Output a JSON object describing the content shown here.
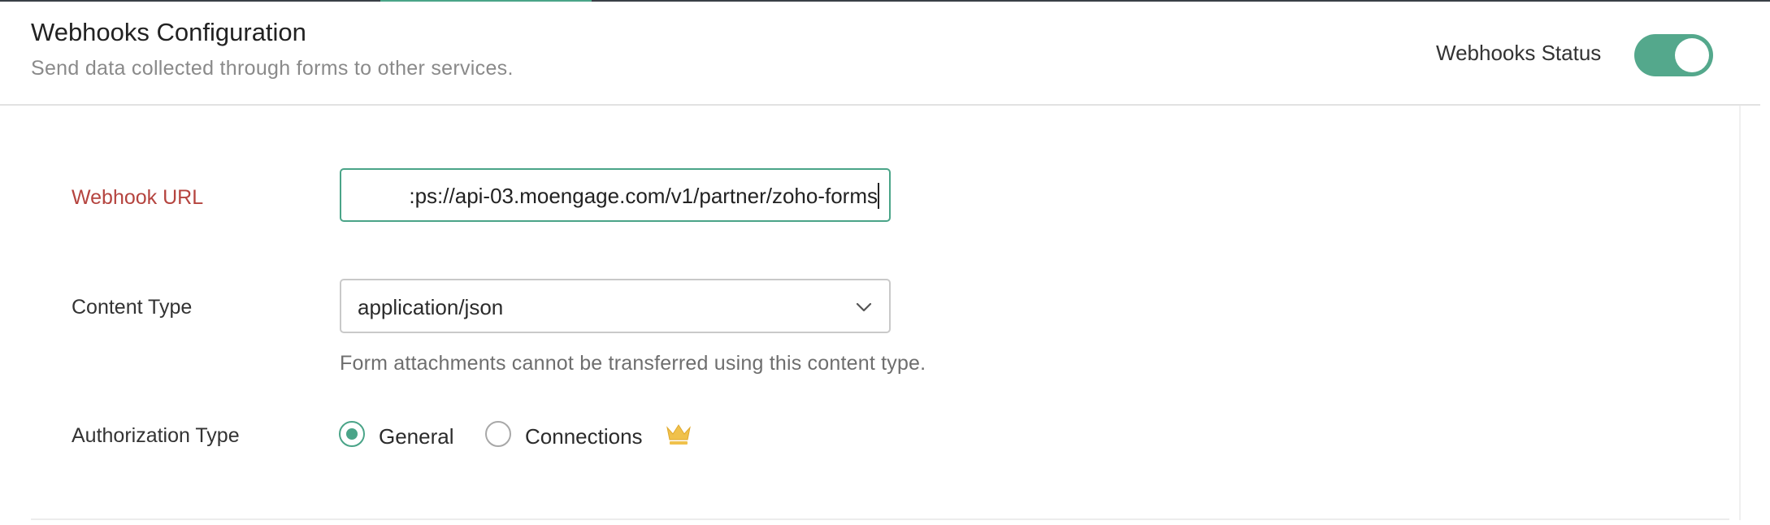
{
  "header": {
    "title": "Webhooks Configuration",
    "subtitle": "Send data collected through forms to other services.",
    "status_label": "Webhooks Status",
    "status_enabled": true
  },
  "form": {
    "webhook_url": {
      "label": "Webhook URL",
      "visible_value": ":ps://api-03.moengage.com/v1/partner/zoho-forms"
    },
    "content_type": {
      "label": "Content Type",
      "selected": "application/json",
      "hint": "Form attachments cannot be transferred using this content type."
    },
    "authorization_type": {
      "label": "Authorization Type",
      "options": [
        {
          "label": "General",
          "checked": true
        },
        {
          "label": "Connections",
          "checked": false,
          "badge_icon": "crown-icon"
        }
      ]
    }
  },
  "colors": {
    "accent": "#4aa488",
    "required_label": "#b5443f",
    "crown": "#f0c14b"
  }
}
